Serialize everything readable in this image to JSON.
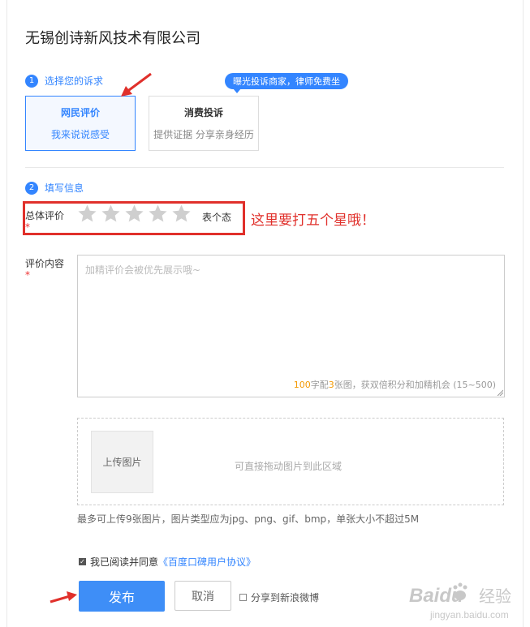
{
  "company_title": "无锡创诗新风技术有限公司",
  "step1": {
    "num": "1",
    "label": "选择您的诉求"
  },
  "options": [
    {
      "title": "网民评价",
      "sub": "我来说说感受",
      "active": true
    },
    {
      "title": "消费投诉",
      "sub": "提供证据 分享亲身经历",
      "active": false
    }
  ],
  "promo_badge": "曝光投诉商家，律师免费坐",
  "step2": {
    "num": "2",
    "label": "填写信息"
  },
  "rating": {
    "label": "总体评价",
    "required_mark": "*",
    "star_count": 5,
    "status_text": "表个态"
  },
  "annotation": "这里要打五个星哦！",
  "review": {
    "label": "评价内容",
    "required_mark": "*",
    "placeholder": "加精评价会被优先展示哦~",
    "counter_pre1": "",
    "counter_num1": "100",
    "counter_mid": "字配",
    "counter_num2": "3",
    "counter_post": "张图，获双倍积分和加精机会 (15~500)"
  },
  "upload": {
    "button": "上传图片",
    "drop_hint": "可直接拖动图片到此区域",
    "note": "最多可上传9张图片，图片类型应为jpg、png、gif、bmp，单张大小不超过5M"
  },
  "agreement": {
    "checked": true,
    "text": "我已阅读并同意",
    "link": "《百度口碑用户协议》"
  },
  "actions": {
    "publish": "发布",
    "cancel": "取消",
    "share_label": "分享到新浪微博"
  },
  "watermark": {
    "brand": "Baidu",
    "cn": "经验",
    "url": "jingyan.baidu.com"
  },
  "colors": {
    "accent": "#3385ff",
    "annotation_red": "#e0302b",
    "star_gray": "#cfcfcf"
  }
}
